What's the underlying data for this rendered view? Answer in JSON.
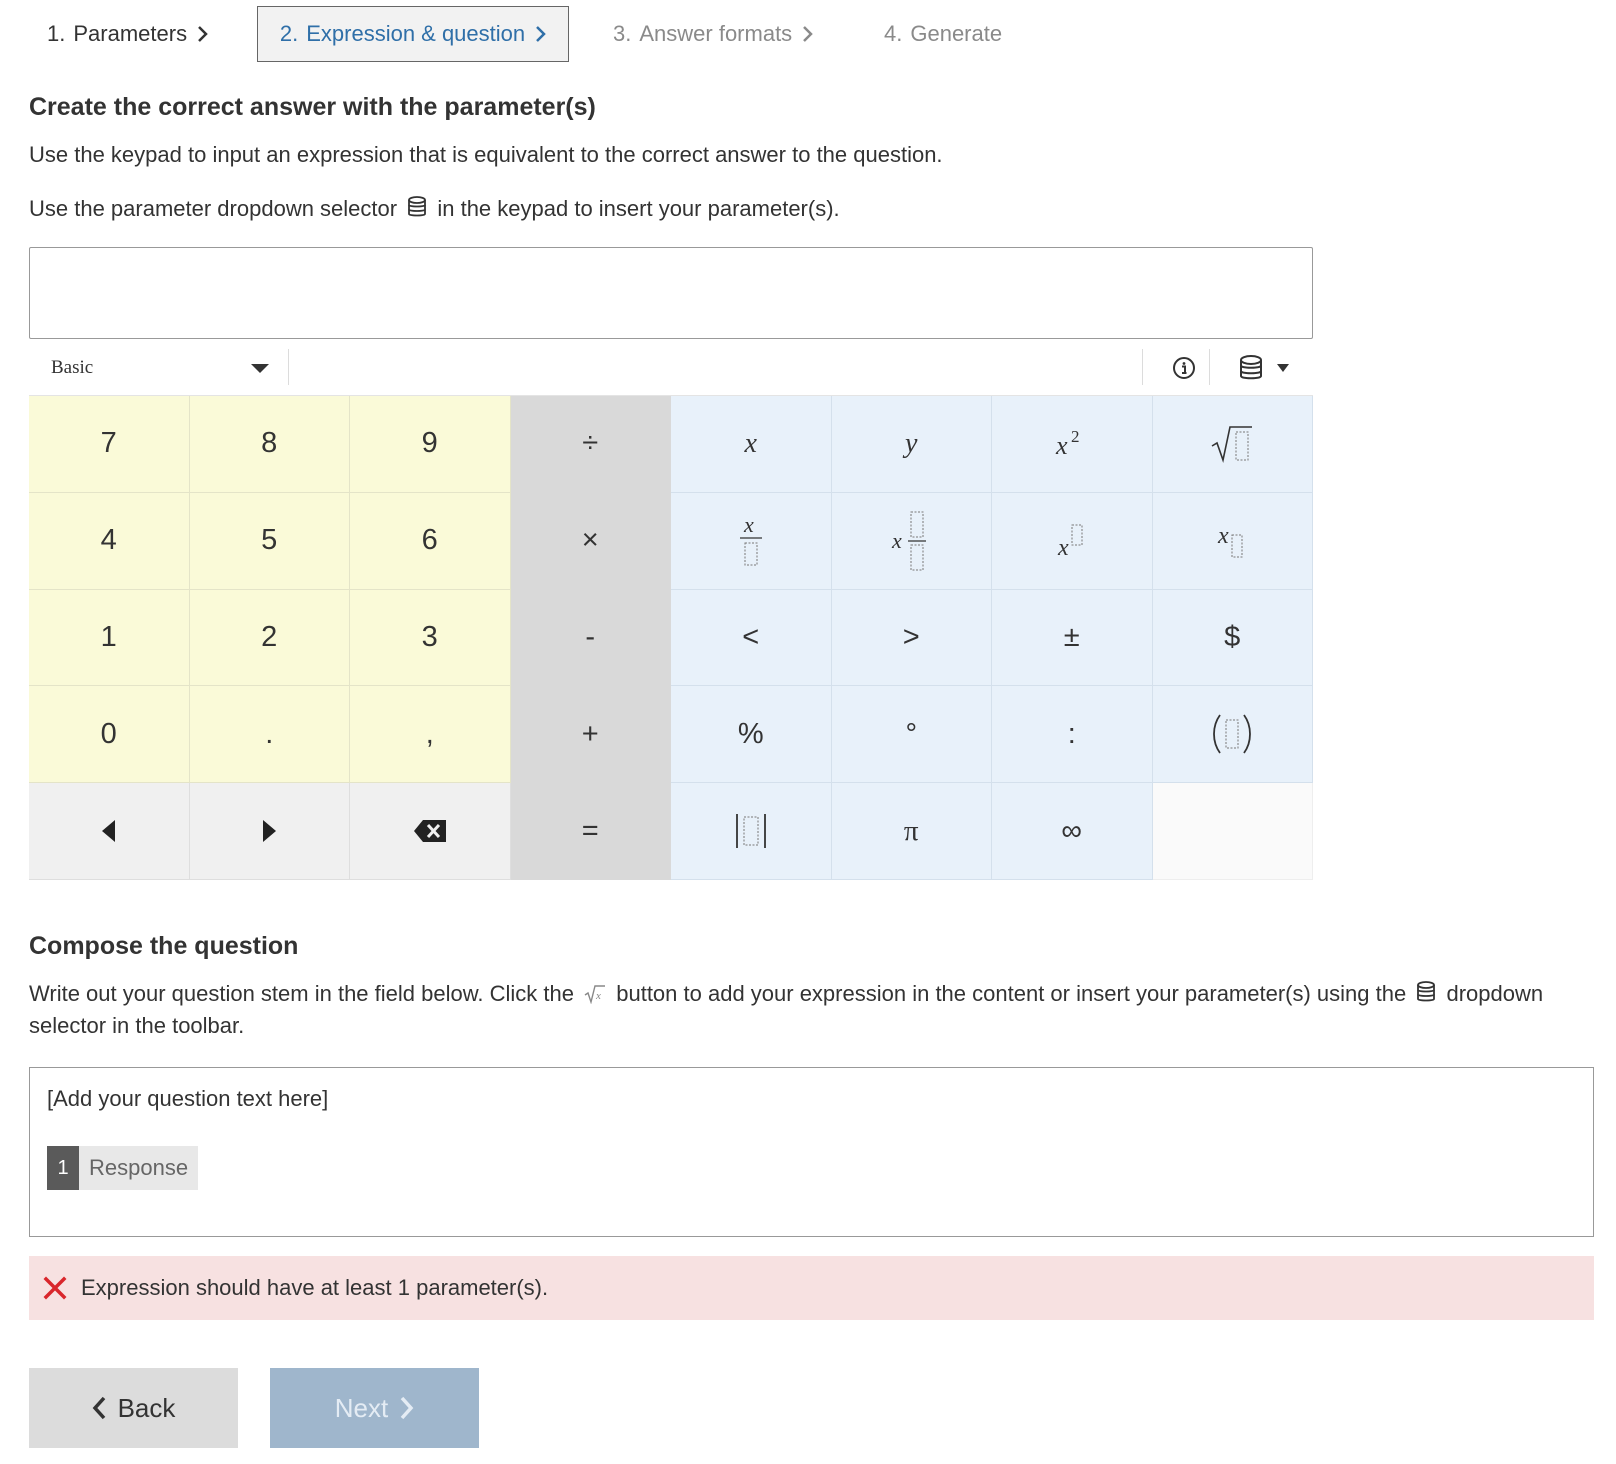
{
  "steps": [
    {
      "num": "1.",
      "label": "Parameters",
      "state": "done"
    },
    {
      "num": "2.",
      "label": "Expression & question",
      "state": "active"
    },
    {
      "num": "3.",
      "label": "Answer formats",
      "state": "upcoming"
    },
    {
      "num": "4.",
      "label": "Generate",
      "state": "upcoming"
    }
  ],
  "answer_section": {
    "title": "Create the correct answer with the parameter(s)",
    "instruction": "Use the keypad to input an expression that is equivalent to the correct answer to the question.",
    "param_hint_before": "Use the parameter dropdown selector",
    "param_hint_after": "in the keypad to insert your parameter(s).",
    "input_value": ""
  },
  "keypad": {
    "mode_selected": "Basic",
    "icons": [
      "info-icon",
      "database-icon",
      "caret-down-icon"
    ],
    "keys": {
      "k7": "7",
      "k8": "8",
      "k9": "9",
      "divide": "÷",
      "var_x": "x",
      "var_y": "y",
      "k4": "4",
      "k5": "5",
      "k6": "6",
      "times": "×",
      "k1": "1",
      "k2": "2",
      "k3": "3",
      "minus": "-",
      "less": "<",
      "greater": ">",
      "plusminus": "±",
      "dollar": "$",
      "k0": "0",
      "dot": ".",
      "comma": ",",
      "plus": "+",
      "percent": "%",
      "degree": "°",
      "colon": ":",
      "equals": "=",
      "pi": "π",
      "infinity": "∞"
    }
  },
  "question_section": {
    "title": "Compose the question",
    "instruction_before": "Write out your question stem in the field below. Click the",
    "instruction_after": "button to add your expression in the content or insert your parameter(s) using the",
    "instruction_end": "dropdown selector in the toolbar.",
    "placeholder_text": "[Add your question text here]",
    "response_index": "1",
    "response_label": "Response"
  },
  "error": {
    "message": "Expression should have at least 1 parameter(s)."
  },
  "nav": {
    "back_label": "Back",
    "next_label": "Next"
  },
  "colors": {
    "active_step": "#2f6fa8",
    "number_keys": "#fafad8",
    "operator_keys": "#d9d9d9",
    "symbol_keys": "#e8f1fa",
    "error_bg": "#f7e1e1",
    "error_icon": "#d9262c",
    "next_disabled": "#9fb6cc"
  }
}
